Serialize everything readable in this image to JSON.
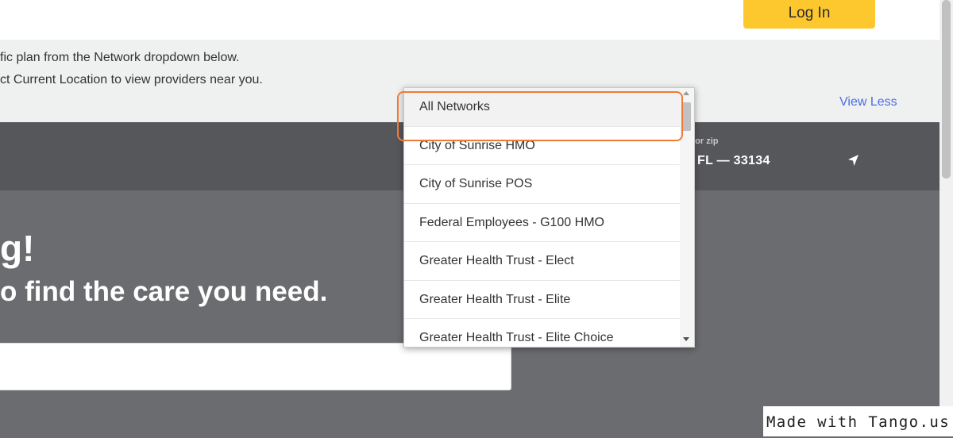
{
  "header": {
    "login_label": "Log In"
  },
  "info": {
    "line1": "fic plan from the Network dropdown below.",
    "line2": "ct Current Location to view providers near you.",
    "view_less": "View Less"
  },
  "search": {
    "location_label": "e or zip",
    "location_value": "FL — 33134",
    "location_icon": "navigation-arrow-icon"
  },
  "hero": {
    "title": "g!",
    "subtitle": "o find the care you need.",
    "input_value": ""
  },
  "network_dropdown": {
    "selected": "All Networks",
    "options": [
      "All Networks",
      "City of Sunrise HMO",
      "City of Sunrise POS",
      "Federal Employees - G100 HMO",
      "Greater Health Trust - Elect",
      "Greater Health Trust - Elite",
      "Greater Health Trust - Elite Choice"
    ]
  },
  "colors": {
    "login_button": "#fdc72e",
    "link": "#4a6ee0",
    "highlight": "#f07a3a",
    "search_band": "#56575b",
    "hero_bg": "#6b6c70"
  },
  "watermark": "Made with Tango.us"
}
